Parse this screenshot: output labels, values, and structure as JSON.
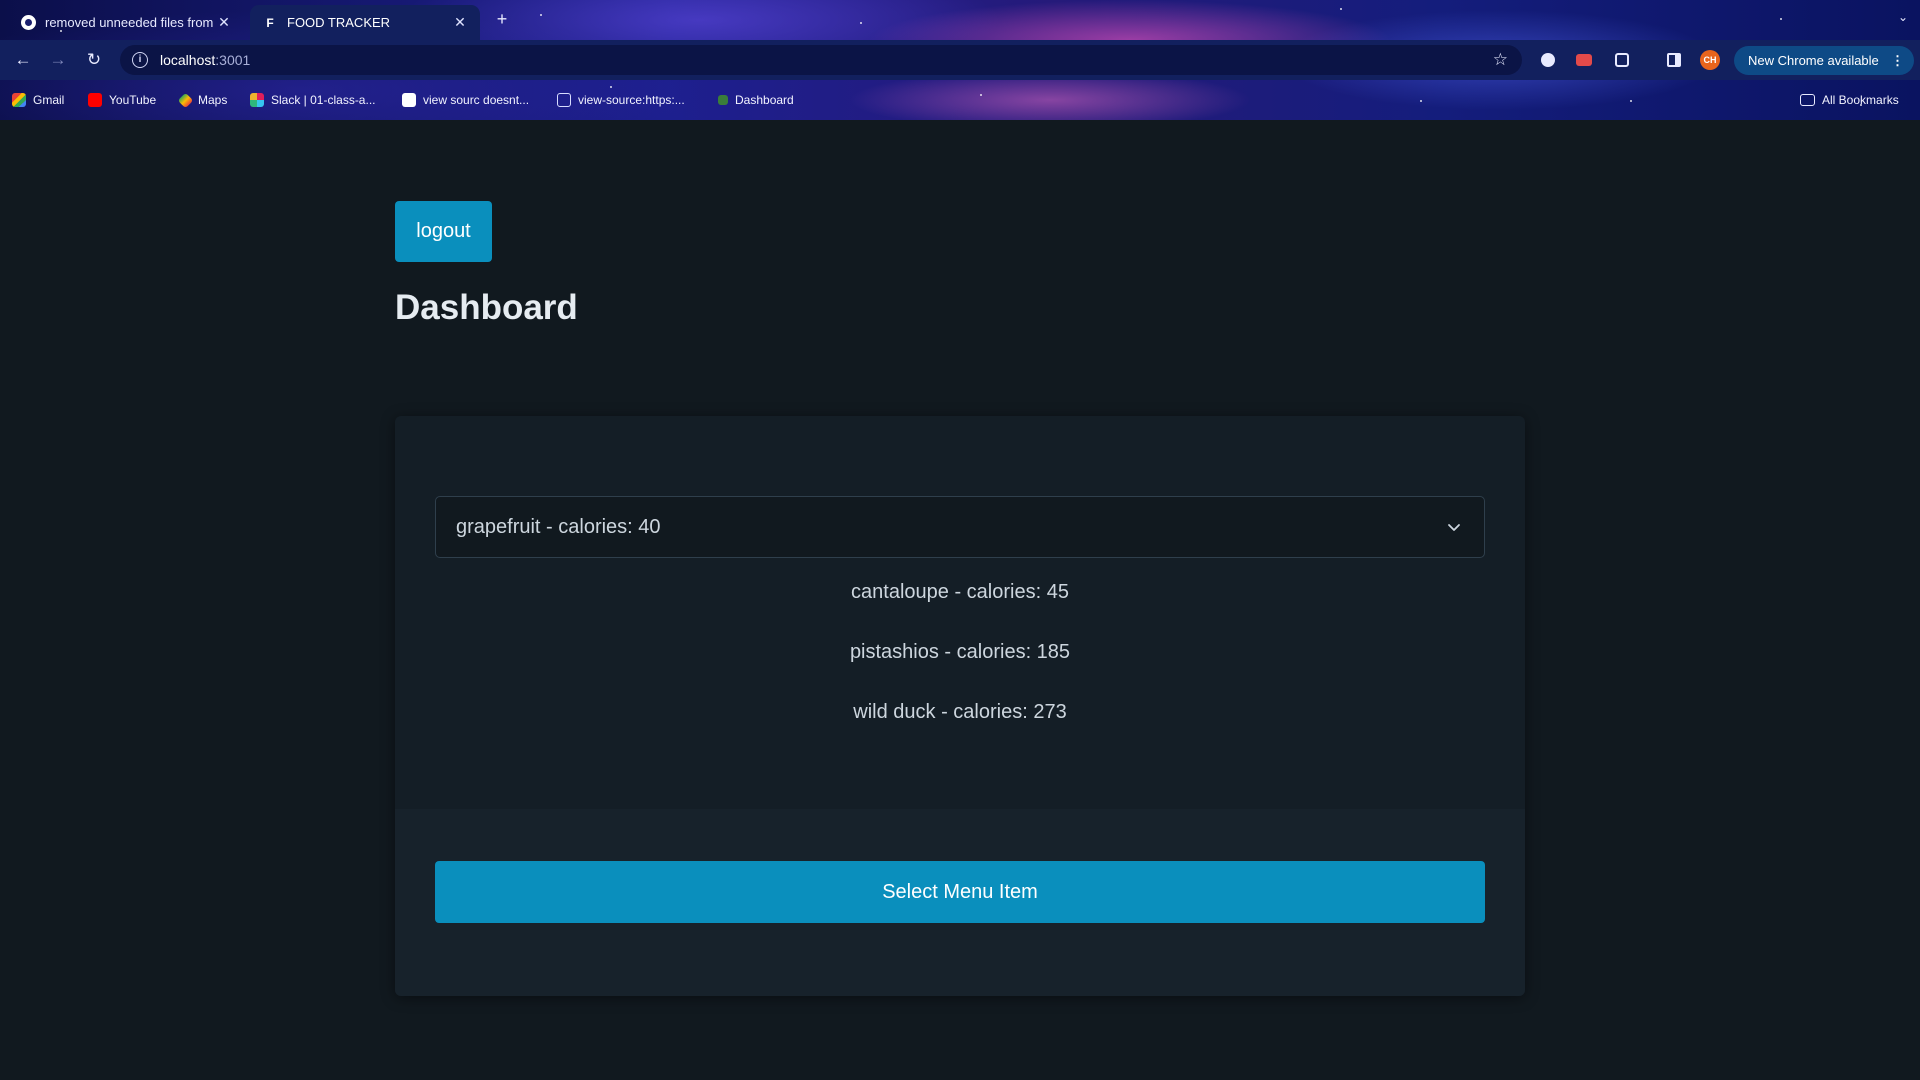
{
  "browser": {
    "tabs": [
      {
        "title": "removed unneeded files from ...",
        "icon": "github-icon",
        "active": false
      },
      {
        "title": "FOOD TRACKER",
        "icon": "favicon-f",
        "favicon_letter": "F",
        "active": true
      }
    ],
    "new_tab_label": "+",
    "address": {
      "host": "localhost",
      "port": ":3001"
    },
    "profile_initials": "CH",
    "update_button_label": "New Chrome available",
    "bookmarks": [
      {
        "label": "Gmail",
        "icon": "gmail-icon"
      },
      {
        "label": "YouTube",
        "icon": "youtube-icon"
      },
      {
        "label": "Maps",
        "icon": "maps-icon"
      },
      {
        "label": "Slack | 01-class-a...",
        "icon": "slack-icon"
      },
      {
        "label": "view sourc doesnt...",
        "icon": "google-icon"
      },
      {
        "label": "view-source:https:...",
        "icon": "globe-icon"
      },
      {
        "label": "Dashboard",
        "icon": "dashboard-icon"
      }
    ],
    "all_bookmarks_label": "All Bookmarks"
  },
  "page": {
    "logout_label": "logout",
    "title": "Dashboard",
    "select": {
      "selected": "grapefruit - calories: 40"
    },
    "items": [
      "cantaloupe - calories: 45",
      "pistashios - calories: 185",
      "wild duck - calories: 273"
    ],
    "select_button_label": "Select Menu Item"
  },
  "colors": {
    "background": "#11191f",
    "card": "#141e26",
    "accent": "#0a8fbd"
  }
}
